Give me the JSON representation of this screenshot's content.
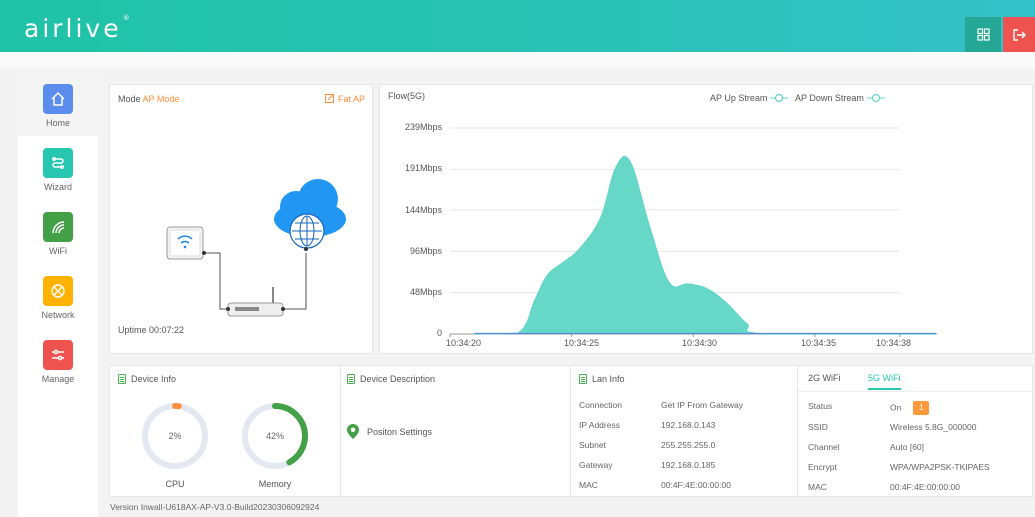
{
  "header": {
    "logo_text": "airlive",
    "logo_mark": "®"
  },
  "sidebar": {
    "items": [
      {
        "label": "Home",
        "icon": "home-icon",
        "color": "#5b8def"
      },
      {
        "label": "Wizard",
        "icon": "wizard-icon",
        "color": "#26c6b0"
      },
      {
        "label": "WiFi",
        "icon": "wifi-icon",
        "color": "#43a047"
      },
      {
        "label": "Network",
        "icon": "network-icon",
        "color": "#ffb300"
      },
      {
        "label": "Manage",
        "icon": "manage-icon",
        "color": "#ef5350"
      }
    ]
  },
  "mode": {
    "label": "Mode",
    "value": "AP Mode",
    "fat_ap": "Fat AP",
    "uptime": "Uptime 00:07:22"
  },
  "flow": {
    "title": "Flow(5G)",
    "legend_up": "AP Up Stream",
    "legend_down": "AP Down Stream",
    "yticks": [
      "239Mbps",
      "191Mbps",
      "144Mbps",
      "96Mbps",
      "48Mbps",
      "0"
    ],
    "xticks": [
      "10:34:20",
      "10:34:25",
      "10:34:30",
      "10:34:35",
      "10:34:38"
    ]
  },
  "chart_data": {
    "type": "area",
    "title": "Flow(5G)",
    "xlabel": "",
    "ylabel": "",
    "ylim": [
      0,
      239
    ],
    "x_tick_labels": [
      "10:34:20",
      "10:34:25",
      "10:34:30",
      "10:34:35",
      "10:34:38"
    ],
    "series": [
      {
        "name": "AP Up Stream",
        "color": "#5fd6c5",
        "x": [
          21.0,
          22.8,
          23.5,
          24.0,
          24.6,
          25.3,
          26.2,
          26.8,
          27.4,
          28.2,
          29.0,
          29.8,
          30.6,
          31.4,
          32.2,
          33.0,
          40.0
        ],
        "y": [
          0,
          1,
          40,
          68,
          82,
          98,
          135,
          192,
          200,
          125,
          60,
          58,
          52,
          35,
          12,
          0,
          0
        ]
      },
      {
        "name": "AP Down Stream",
        "color": "#4f8bd8",
        "x": [
          21.0,
          40.0
        ],
        "y": [
          0,
          0
        ]
      }
    ]
  },
  "device_info": {
    "title": "Device Info",
    "cpu_label": "CPU",
    "cpu_value": "2%",
    "cpu_percent": 2,
    "mem_label": "Memory",
    "mem_value": "42%",
    "mem_percent": 42
  },
  "device_description": {
    "title": "Device Description",
    "position_settings": "Positon Settings"
  },
  "lan_info": {
    "title": "Lan Info",
    "rows": [
      {
        "label": "Connection",
        "value": "Get IP From Gateway"
      },
      {
        "label": "IP Address",
        "value": "192.168.0.143"
      },
      {
        "label": "Subnet",
        "value": "255.255.255.0"
      },
      {
        "label": "Gateway",
        "value": "192.168.0.185"
      },
      {
        "label": "MAC",
        "value": "00:4F:4E:00:00:00"
      }
    ]
  },
  "wifi": {
    "tab_2g": "2G WiFi",
    "tab_5g": "5G WiFi",
    "rows": [
      {
        "label": "Status",
        "value": "On",
        "badge": "1"
      },
      {
        "label": "SSID",
        "value": "Wireless 5.8G_000000"
      },
      {
        "label": "Channel",
        "value": "Auto [60]"
      },
      {
        "label": "Encrypt",
        "value": "WPA/WPA2PSK-TKIPAES"
      },
      {
        "label": "MAC",
        "value": "00:4F:4E:00:00:00"
      }
    ]
  },
  "footer": {
    "version": "Version  Inwall-U618AX-AP-V3.0-Build20230306092924"
  }
}
